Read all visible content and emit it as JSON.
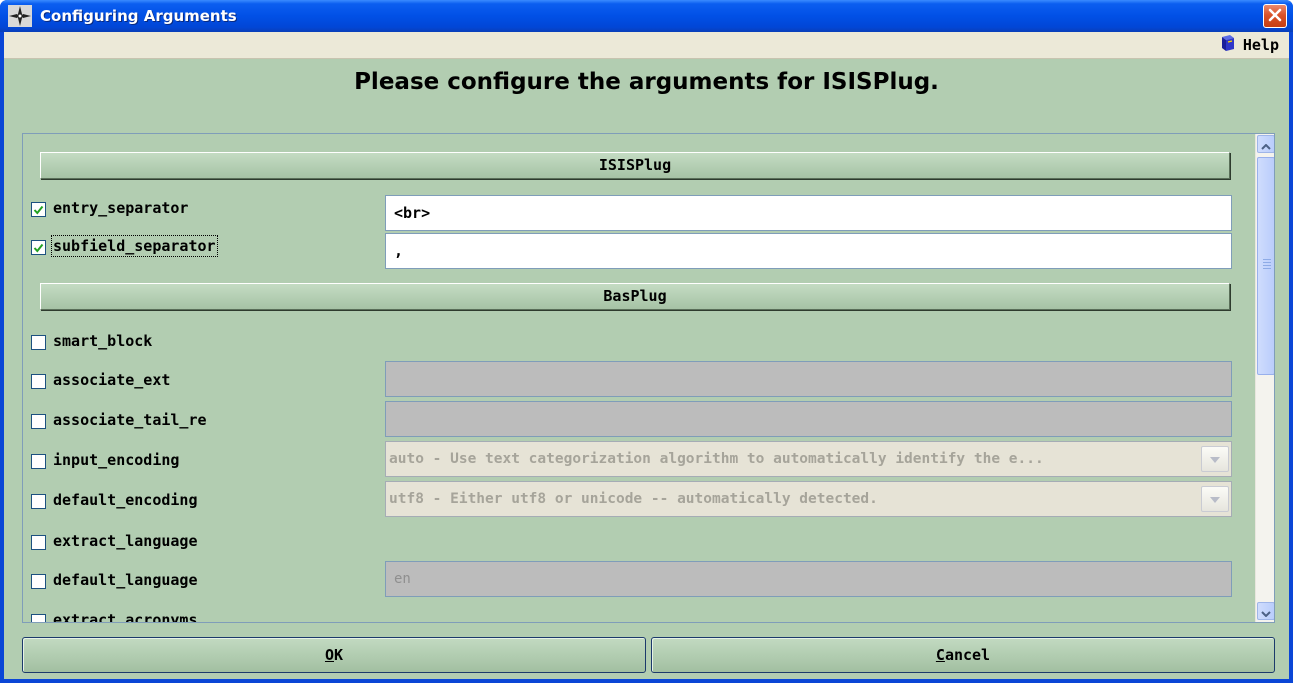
{
  "window": {
    "title": "Configuring Arguments",
    "icon": "app-compass-icon",
    "close_icon": "close-icon"
  },
  "menu": {
    "help_label": "Help",
    "help_icon": "help-book-icon"
  },
  "heading": "Please configure the arguments for ISISPlug.",
  "sections": [
    {
      "title": "ISISPlug",
      "args": [
        {
          "name": "entry_separator",
          "checked": true,
          "value": "<br>",
          "control": "text",
          "enabled": true
        },
        {
          "name": "subfield_separator",
          "checked": true,
          "value": ",",
          "control": "text",
          "enabled": true
        }
      ]
    },
    {
      "title": "BasPlug",
      "args": [
        {
          "name": "smart_block",
          "checked": false,
          "control": "none"
        },
        {
          "name": "associate_ext",
          "checked": false,
          "value": "",
          "control": "text",
          "enabled": false
        },
        {
          "name": "associate_tail_re",
          "checked": false,
          "value": "",
          "control": "text",
          "enabled": false
        },
        {
          "name": "input_encoding",
          "checked": false,
          "value": "auto - Use text categorization algorithm to automatically identify the e...",
          "control": "combo",
          "enabled": false
        },
        {
          "name": "default_encoding",
          "checked": false,
          "value": "utf8 - Either utf8 or unicode -- automatically detected.",
          "control": "combo",
          "enabled": false
        },
        {
          "name": "extract_language",
          "checked": false,
          "control": "none"
        },
        {
          "name": "default_language",
          "checked": false,
          "value": "en",
          "control": "text",
          "enabled": false
        },
        {
          "name": "extract_acronyms",
          "checked": false,
          "control": "none"
        }
      ]
    }
  ],
  "buttons": {
    "ok_mnemonic": "O",
    "ok_rest": "K",
    "cancel_mnemonic": "C",
    "cancel_rest": "ancel"
  },
  "colors": {
    "panel_bg": "#b2cdb1",
    "titlebar": "#0150e6",
    "menubar": "#ece9d8"
  }
}
